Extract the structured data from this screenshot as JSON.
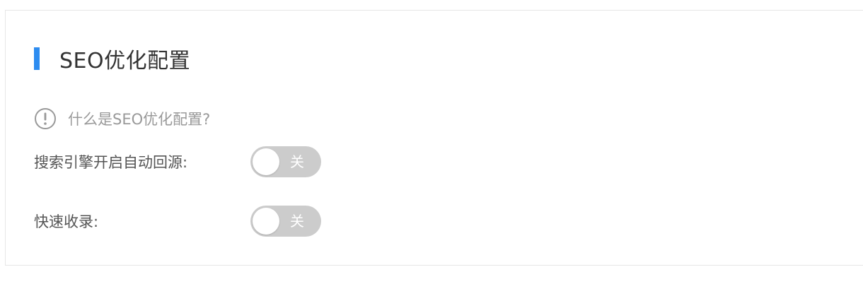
{
  "section": {
    "title": "SEO优化配置",
    "accent_color": "#2d8cf0"
  },
  "help": {
    "icon": "exclamation-circle-icon",
    "text": "什么是SEO优化配置?"
  },
  "settings": [
    {
      "label": "搜索引擎开启自动回源:",
      "toggle_state": "off",
      "toggle_text": "关"
    },
    {
      "label": "快速收录:",
      "toggle_state": "off",
      "toggle_text": "关"
    }
  ],
  "colors": {
    "toggle_off_bg": "#cccccc",
    "label_text": "#555555",
    "help_text": "#999999"
  }
}
